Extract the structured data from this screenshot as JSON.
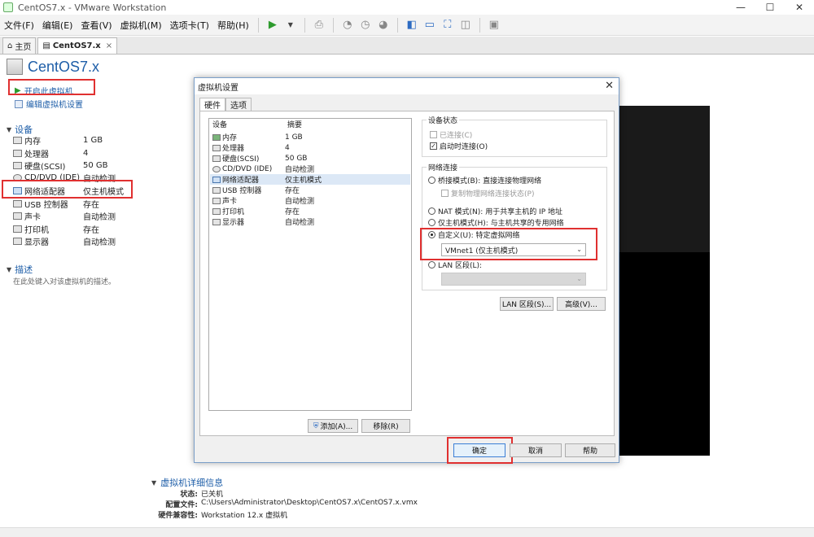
{
  "window": {
    "title": "CentOS7.x - VMware Workstation",
    "min": "—",
    "max": "☐",
    "close": "✕"
  },
  "menu": [
    "文件(F)",
    "编辑(E)",
    "查看(V)",
    "虚拟机(M)",
    "选项卡(T)",
    "帮助(H)"
  ],
  "tabs": {
    "home": "主页",
    "vm": "CentOS7.x",
    "close": "×"
  },
  "vm": {
    "name": "CentOS7.x",
    "power_on": "开启此虚拟机",
    "edit_settings": "编辑虚拟机设置"
  },
  "devices_section": {
    "title": "设备",
    "items": [
      {
        "name": "内存",
        "value": "1 GB",
        "icon": "memory-icon"
      },
      {
        "name": "处理器",
        "value": "4",
        "icon": "cpu-icon"
      },
      {
        "name": "硬盘(SCSI)",
        "value": "50 GB",
        "icon": "disk-icon"
      },
      {
        "name": "CD/DVD (IDE)",
        "value": "自动检测",
        "icon": "cdrom-icon"
      },
      {
        "name": "网络适配器",
        "value": "仅主机模式",
        "icon": "network-icon"
      },
      {
        "name": "USB 控制器",
        "value": "存在",
        "icon": "usb-icon"
      },
      {
        "name": "声卡",
        "value": "自动检测",
        "icon": "sound-icon"
      },
      {
        "name": "打印机",
        "value": "存在",
        "icon": "printer-icon"
      },
      {
        "name": "显示器",
        "value": "自动检测",
        "icon": "display-icon"
      }
    ]
  },
  "description": {
    "title": "描述",
    "placeholder": "在此处键入对该虚拟机的描述。"
  },
  "details": {
    "title": "虚拟机详细信息",
    "rows": [
      {
        "key": "状态:",
        "value": "已关机"
      },
      {
        "key": "配置文件:",
        "value": "C:\\Users\\Administrator\\Desktop\\CentOS7.x\\CentOS7.x.vmx"
      },
      {
        "key": "硬件兼容性:",
        "value": "Workstation 12.x 虚拟机"
      }
    ]
  },
  "dialog": {
    "title": "虚拟机设置",
    "close": "✕",
    "tabs": [
      "硬件",
      "选项"
    ],
    "list_header": {
      "device": "设备",
      "summary": "摘要"
    },
    "list": [
      {
        "name": "内存",
        "value": "1 GB"
      },
      {
        "name": "处理器",
        "value": "4"
      },
      {
        "name": "硬盘(SCSI)",
        "value": "50 GB"
      },
      {
        "name": "CD/DVD (IDE)",
        "value": "自动检测"
      },
      {
        "name": "网络适配器",
        "value": "仅主机模式"
      },
      {
        "name": "USB 控制器",
        "value": "存在"
      },
      {
        "name": "声卡",
        "value": "自动检测"
      },
      {
        "name": "打印机",
        "value": "存在"
      },
      {
        "name": "显示器",
        "value": "自动检测"
      }
    ],
    "add_button": "添加(A)...",
    "remove_button": "移除(R)",
    "device_status": {
      "title": "设备状态",
      "connected": "已连接(C)",
      "connect_at_power_on": "启动时连接(O)",
      "connected_checked": false,
      "power_on_checked": true
    },
    "network": {
      "title": "网络连接",
      "bridged": "桥接模式(B): 直接连接物理网络",
      "replicate": "复制物理网络连接状态(P)",
      "nat": "NAT 模式(N): 用于共享主机的 IP 地址",
      "host_only": "仅主机模式(H): 与主机共享的专用网络",
      "custom": "自定义(U): 特定虚拟网络",
      "custom_value": "VMnet1 (仅主机模式)",
      "lan": "LAN 区段(L):",
      "lan_value": "",
      "selected": "custom"
    },
    "lan_segments_button": "LAN 区段(S)...",
    "advanced_button": "高级(V)...",
    "ok": "确定",
    "cancel": "取消",
    "help": "帮助"
  },
  "colors": {
    "accent": "#1e5ea8",
    "highlight_box": "#e03030",
    "play_green": "#2e9b2e"
  }
}
